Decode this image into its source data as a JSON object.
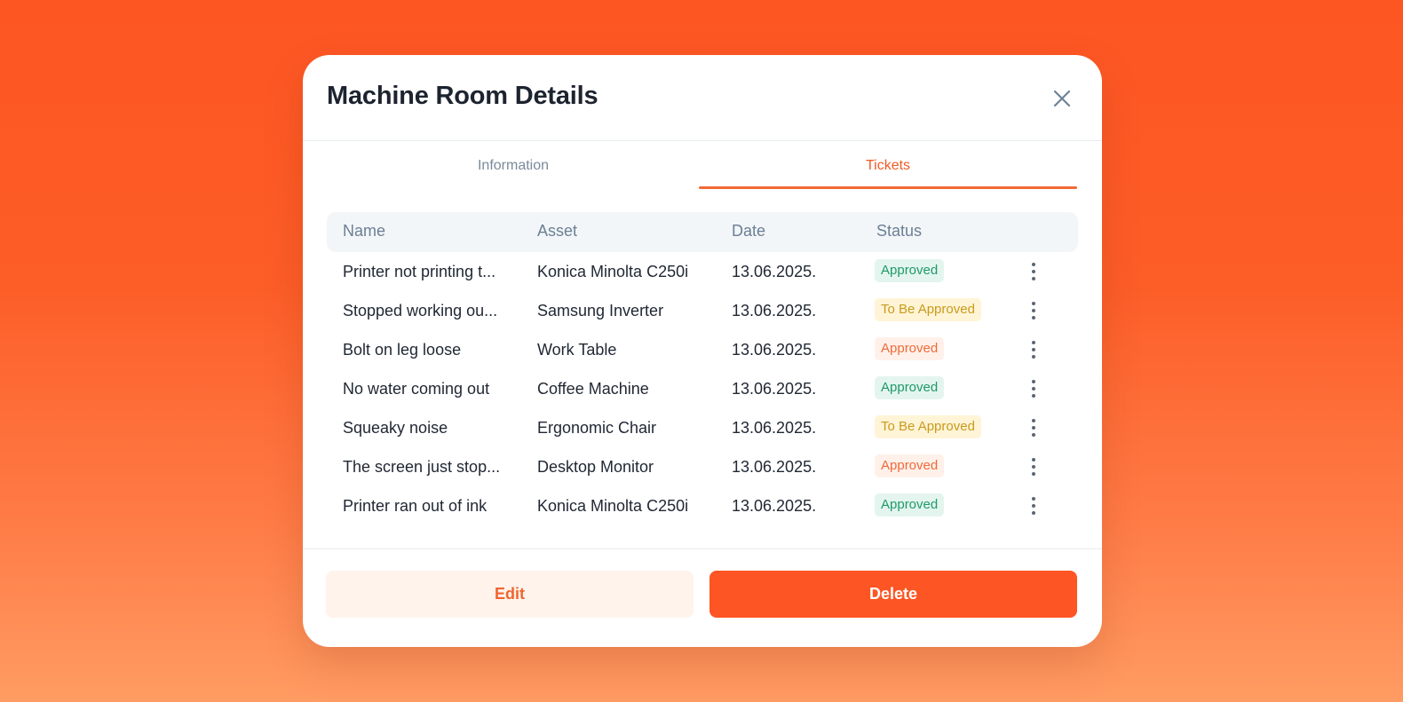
{
  "modal": {
    "title": "Machine Room Details"
  },
  "tabs": [
    {
      "label": "Information",
      "active": false
    },
    {
      "label": "Tickets",
      "active": true
    }
  ],
  "table": {
    "columns": [
      "Name",
      "Asset",
      "Date",
      "Status"
    ],
    "rows": [
      {
        "name": "Printer not printing t...",
        "asset": "Konica Minolta C250i",
        "date": "13.06.2025.",
        "status": "Approved",
        "status_color": "green"
      },
      {
        "name": "Stopped working ou...",
        "asset": "Samsung Inverter",
        "date": "13.06.2025.",
        "status": "To Be Approved",
        "status_color": "yellow"
      },
      {
        "name": "Bolt on leg loose",
        "asset": "Work Table",
        "date": "13.06.2025.",
        "status": "Approved",
        "status_color": "orange"
      },
      {
        "name": "No water coming out",
        "asset": "Coffee Machine",
        "date": "13.06.2025.",
        "status": "Approved",
        "status_color": "green"
      },
      {
        "name": "Squeaky noise",
        "asset": "Ergonomic Chair",
        "date": "13.06.2025.",
        "status": "To Be Approved",
        "status_color": "yellow"
      },
      {
        "name": "The screen just stop...",
        "asset": "Desktop Monitor",
        "date": "13.06.2025.",
        "status": "Approved",
        "status_color": "orange"
      },
      {
        "name": "Printer ran out of ink",
        "asset": "Konica Minolta C250i",
        "date": "13.06.2025.",
        "status": "Approved",
        "status_color": "green"
      }
    ]
  },
  "footer": {
    "edit_label": "Edit",
    "delete_label": "Delete"
  },
  "icons": {
    "close": "close-icon",
    "row_menu": "more-vertical-icon"
  },
  "colors": {
    "accent": "#fd5523",
    "approved_green": "#1f9a6a",
    "pending_yellow": "#c99a1c",
    "approved_orange": "#f06a3a"
  }
}
